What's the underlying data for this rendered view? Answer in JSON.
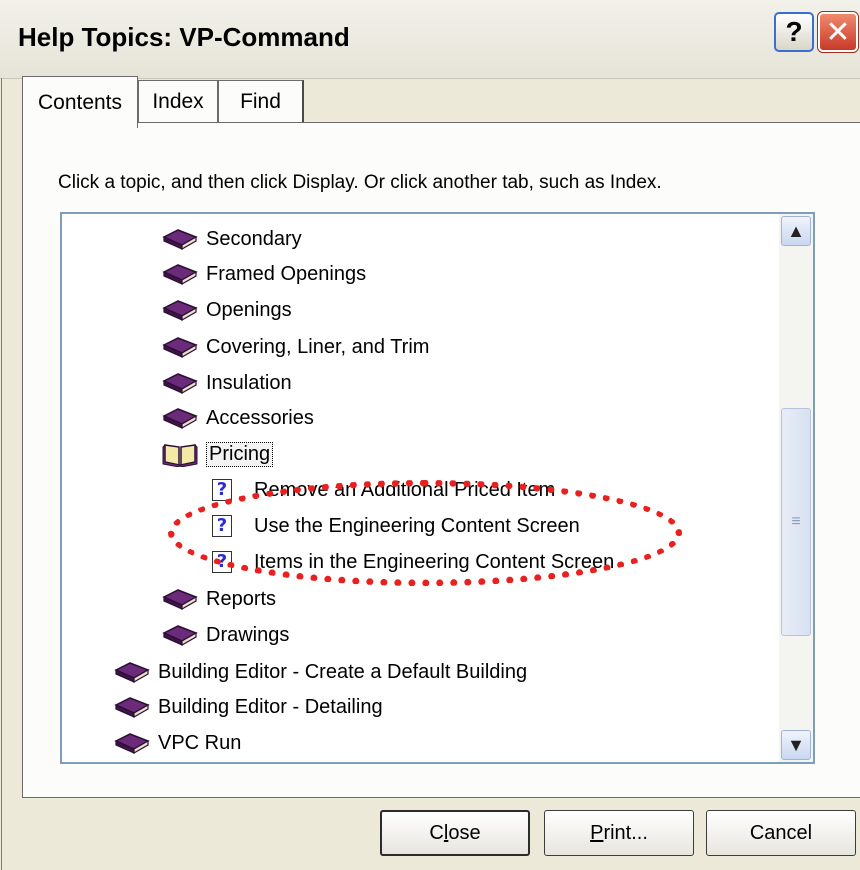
{
  "window": {
    "title": "Help Topics: VP-Command",
    "help_button": "?",
    "close_button": "✕"
  },
  "tabs": [
    {
      "label": "Contents",
      "active": true
    },
    {
      "label": "Index",
      "active": false
    },
    {
      "label": "Find",
      "active": false
    }
  ],
  "instruction": "Click a topic, and then click Display. Or click another tab, such as Index.",
  "tree": {
    "items": [
      {
        "label": "Secondary",
        "icon": "closed-book-icon"
      },
      {
        "label": "Framed Openings",
        "icon": "closed-book-icon"
      },
      {
        "label": "Openings",
        "icon": "closed-book-icon"
      },
      {
        "label": "Covering, Liner, and Trim",
        "icon": "closed-book-icon"
      },
      {
        "label": "Insulation",
        "icon": "closed-book-icon"
      },
      {
        "label": "Accessories",
        "icon": "closed-book-icon"
      },
      {
        "label": "Pricing",
        "icon": "open-book-icon",
        "selected": true
      },
      {
        "label": "Remove an Additional Priced Item",
        "icon": "help-topic-icon"
      },
      {
        "label": "Use the Engineering Content Screen",
        "icon": "help-topic-icon"
      },
      {
        "label": "Items in the Engineering Content Screen",
        "icon": "help-topic-icon"
      },
      {
        "label": "Reports",
        "icon": "closed-book-icon"
      },
      {
        "label": "Drawings",
        "icon": "closed-book-icon"
      },
      {
        "label": "Building Editor - Create a Default Building",
        "icon": "closed-book-icon"
      },
      {
        "label": "Building Editor - Detailing",
        "icon": "closed-book-icon"
      },
      {
        "label": "VPC Run",
        "icon": "closed-book-icon"
      }
    ]
  },
  "buttons": {
    "close": {
      "pre": "C",
      "u": "l",
      "post": "ose"
    },
    "print": {
      "pre": "",
      "u": "P",
      "post": "rint..."
    },
    "cancel": "Cancel"
  },
  "colors": {
    "annotation": "#e8201f",
    "book": "#6b2a7a"
  }
}
